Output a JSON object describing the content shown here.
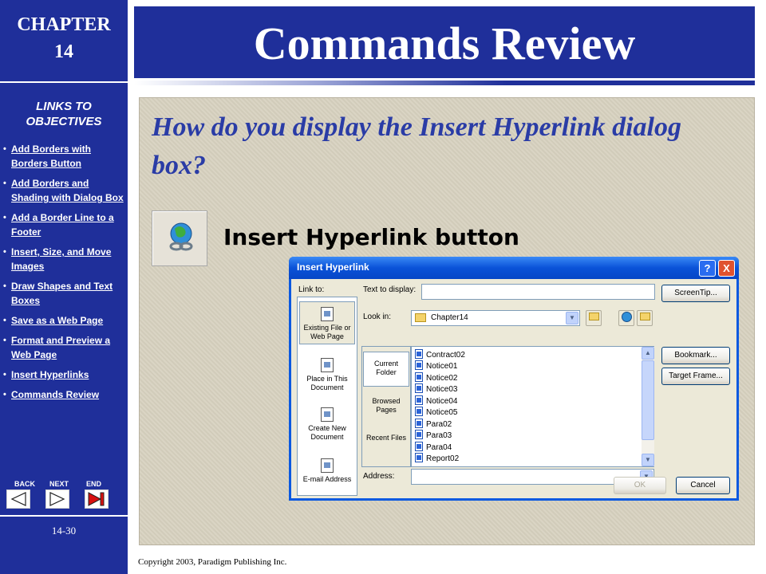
{
  "sidebar": {
    "chapter_label": "CHAPTER",
    "chapter_number": "14",
    "links_heading_line1": "LINKS TO",
    "links_heading_line2": "OBJECTIVES",
    "links": [
      "Add Borders with Borders Button",
      "Add Borders and Shading with Dialog Box",
      "Add a Border Line to a Footer",
      "Insert, Size, and Move Images",
      "Draw Shapes and Text Boxes",
      "Save as a Web Page",
      "Format and Preview a Web Page",
      "Insert Hyperlinks",
      "Commands Review"
    ],
    "nav": {
      "back": "BACK",
      "next": "NEXT",
      "end": "END"
    },
    "page_number": "14-30"
  },
  "title": "Commands Review",
  "question": "How do you display the Insert Hyperlink dialog box?",
  "button_caption": "Insert Hyperlink button",
  "dialog": {
    "title": "Insert Hyperlink",
    "help": "?",
    "close": "X",
    "link_to_label": "Link to:",
    "text_to_display_label": "Text to display:",
    "text_to_display_value": "",
    "screentip": "ScreenTip...",
    "look_in_label": "Look in:",
    "look_in_value": "Chapter14",
    "link_items": [
      "Existing File or Web Page",
      "Place in This Document",
      "Create New Document",
      "E-mail Address"
    ],
    "look_tabs": [
      "Current Folder",
      "Browsed Pages",
      "Recent Files"
    ],
    "files": [
      "Contract02",
      "Notice01",
      "Notice02",
      "Notice03",
      "Notice04",
      "Notice05",
      "Para02",
      "Para03",
      "Para04",
      "Report02"
    ],
    "bookmark": "Bookmark...",
    "target_frame": "Target Frame...",
    "address_label": "Address:",
    "address_value": "",
    "ok": "OK",
    "cancel": "Cancel"
  },
  "copyright": "Copyright 2003, Paradigm Publishing Inc.",
  "colors": {
    "brand_blue": "#1f2f9a",
    "question_blue": "#2a3ca6",
    "panel_tan": "#d8d2c0",
    "xp_title_blue": "#0a52d8"
  }
}
